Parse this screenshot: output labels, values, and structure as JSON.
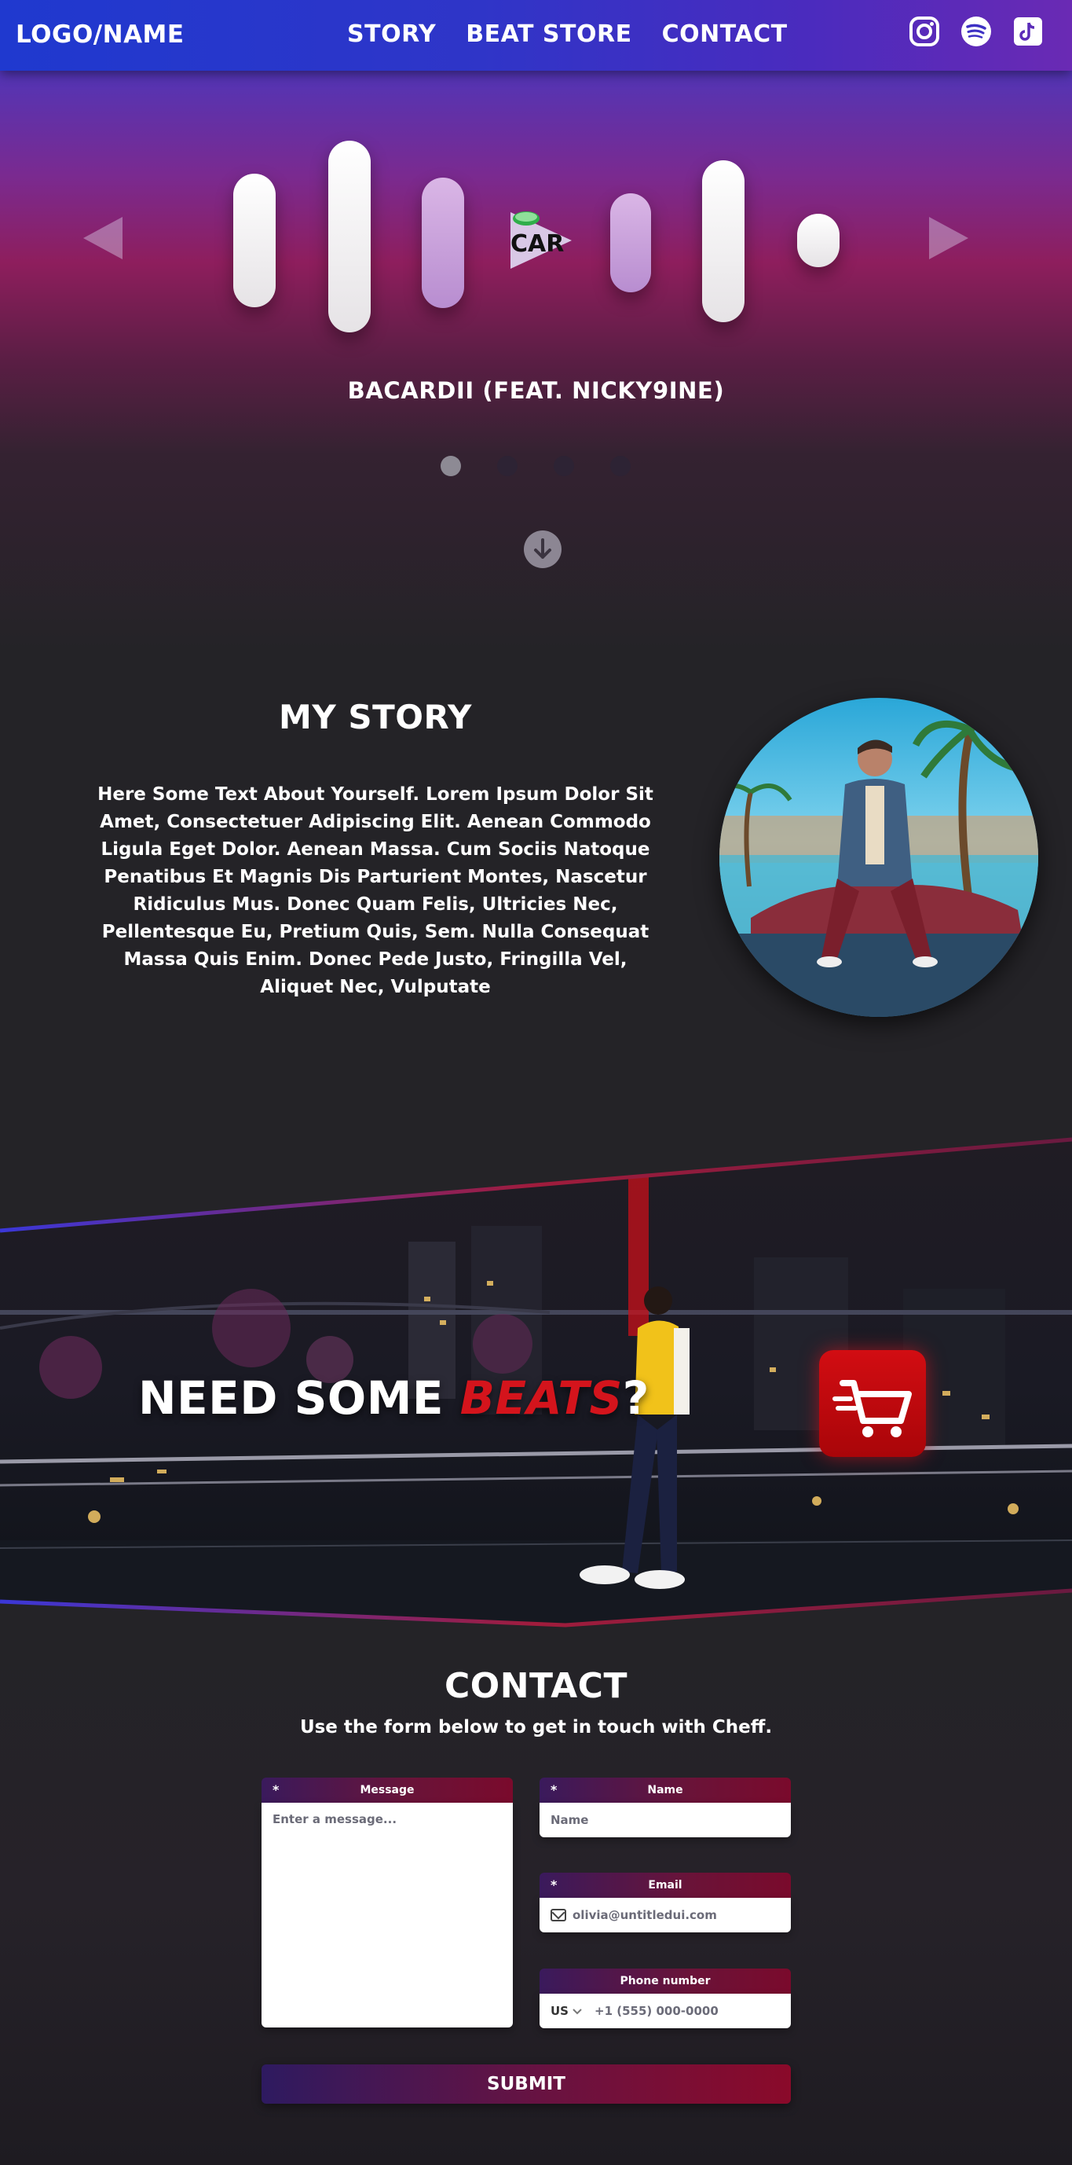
{
  "nav": {
    "logo": "LOGO/NAME",
    "links": [
      "STORY",
      "BEAT STORE",
      "CONTACT"
    ],
    "social_icons": [
      "instagram-icon",
      "spotify-icon",
      "tiktok-icon"
    ]
  },
  "player": {
    "track_title": "BACARDII (FEAT. NICKY9INE)",
    "cover_text": "CAR",
    "slides": 4,
    "active_slide": 1
  },
  "story": {
    "title": "MY STORY",
    "body": "Here Some Text About Yourself. Lorem Ipsum Dolor Sit Amet, Consectetuer Adipiscing Elit. Aenean Commodo Ligula Eget Dolor. Aenean Massa. Cum Sociis Natoque Penatibus Et Magnis Dis Parturient Montes, Nascetur Ridiculus Mus. Donec Quam Felis, Ultricies Nec, Pellentesque Eu, Pretium Quis, Sem. Nulla Consequat Massa Quis Enim. Donec Pede Justo, Fringilla Vel, Aliquet Nec, Vulputate"
  },
  "beats": {
    "heading_prefix": "NEED SOME ",
    "heading_highlight": "BEATS",
    "heading_suffix": "?"
  },
  "contact": {
    "title": "CONTACT",
    "subtitle": "Use the form below to get in touch with Cheff.",
    "required_mark": "*",
    "message": {
      "label": "Message",
      "placeholder": "Enter a message..."
    },
    "name": {
      "label": "Name",
      "placeholder": "Name"
    },
    "email": {
      "label": "Email",
      "placeholder": "olivia@untitledui.com"
    },
    "phone": {
      "label": "Phone number",
      "country": "US",
      "placeholder": "+1 (555) 000-0000"
    },
    "submit": "SUBMIT"
  },
  "colors": {
    "nav_start": "#1f39cf",
    "nav_end": "#6a2ab4",
    "accent_red": "#d4141c",
    "form_gradient_start": "#3a1a5c",
    "form_gradient_end": "#7a0a2c"
  }
}
